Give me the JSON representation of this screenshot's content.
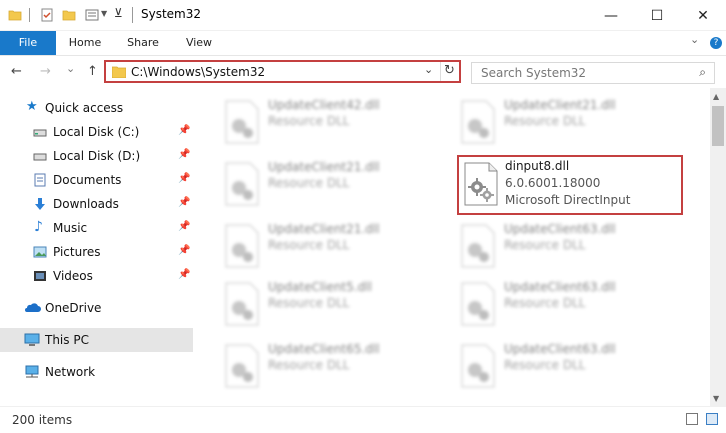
{
  "window": {
    "title": "System32",
    "minimize_glyph": "—",
    "maximize_glyph": "☐",
    "close_glyph": "✕"
  },
  "quick_access_toolbar": {
    "icons": [
      "folder-icon",
      "properties-icon",
      "new-folder-icon",
      "customize-icon",
      "dropdown-icon"
    ]
  },
  "ribbon": {
    "tabs": [
      "File",
      "Home",
      "Share",
      "View"
    ],
    "expand_glyph": "⌄",
    "help_glyph": "?"
  },
  "address_bar": {
    "back_glyph": "←",
    "forward_glyph": "→",
    "recent_glyph": "⌄",
    "up_glyph": "↑",
    "path": "C:\\Windows\\System32",
    "dropdown_glyph": "⌄",
    "refresh_glyph": "↻"
  },
  "search": {
    "placeholder": "Search System32",
    "icon_glyph": "⌕"
  },
  "nav_pane": {
    "items": [
      {
        "label": "Quick access",
        "icon": "star-icon",
        "pinned": false
      },
      {
        "label": "Local Disk (C:)",
        "icon": "drive-icon",
        "pinned": true
      },
      {
        "label": "Local Disk (D:)",
        "icon": "drive-icon",
        "pinned": true
      },
      {
        "label": "Documents",
        "icon": "documents-icon",
        "pinned": true
      },
      {
        "label": "Downloads",
        "icon": "download-icon",
        "pinned": true
      },
      {
        "label": "Music",
        "icon": "music-icon",
        "pinned": true
      },
      {
        "label": "Pictures",
        "icon": "pictures-icon",
        "pinned": true
      },
      {
        "label": "Videos",
        "icon": "videos-icon",
        "pinned": true
      },
      {
        "label": "OneDrive",
        "icon": "cloud-icon",
        "pinned": false
      },
      {
        "label": "This PC",
        "icon": "computer-icon",
        "pinned": false,
        "selected": true
      },
      {
        "label": "Network",
        "icon": "network-icon",
        "pinned": false
      }
    ],
    "pin_glyph": "📌"
  },
  "files": {
    "featured": {
      "name": "dinput8.dll",
      "version": "6.0.6001.18000",
      "description": "Microsoft DirectInput"
    },
    "blurred": [
      {
        "name": "UpdateClient42.dll",
        "desc": "Resource DLL"
      },
      {
        "name": "UpdateClient21.dll",
        "desc": "Resource DLL"
      },
      {
        "name": "UpdateClient21.dll",
        "desc": "Resource DLL"
      },
      {
        "name": "UpdateClient21.dll",
        "desc": "Resource DLL"
      },
      {
        "name": "UpdateClient63.dll",
        "desc": "Resource DLL"
      },
      {
        "name": "UpdateClient5.dll",
        "desc": "Resource DLL"
      },
      {
        "name": "UpdateClient63.dll",
        "desc": "Resource DLL"
      },
      {
        "name": "UpdateClient65.dll",
        "desc": "Resource DLL"
      },
      {
        "name": "UpdateClient63.dll",
        "desc": "Resource DLL"
      }
    ]
  },
  "status_bar": {
    "item_count": "200 items"
  },
  "colors": {
    "accent": "#1979ca",
    "highlight_border": "#c44040",
    "selected_nav": "#e5e5e5"
  }
}
